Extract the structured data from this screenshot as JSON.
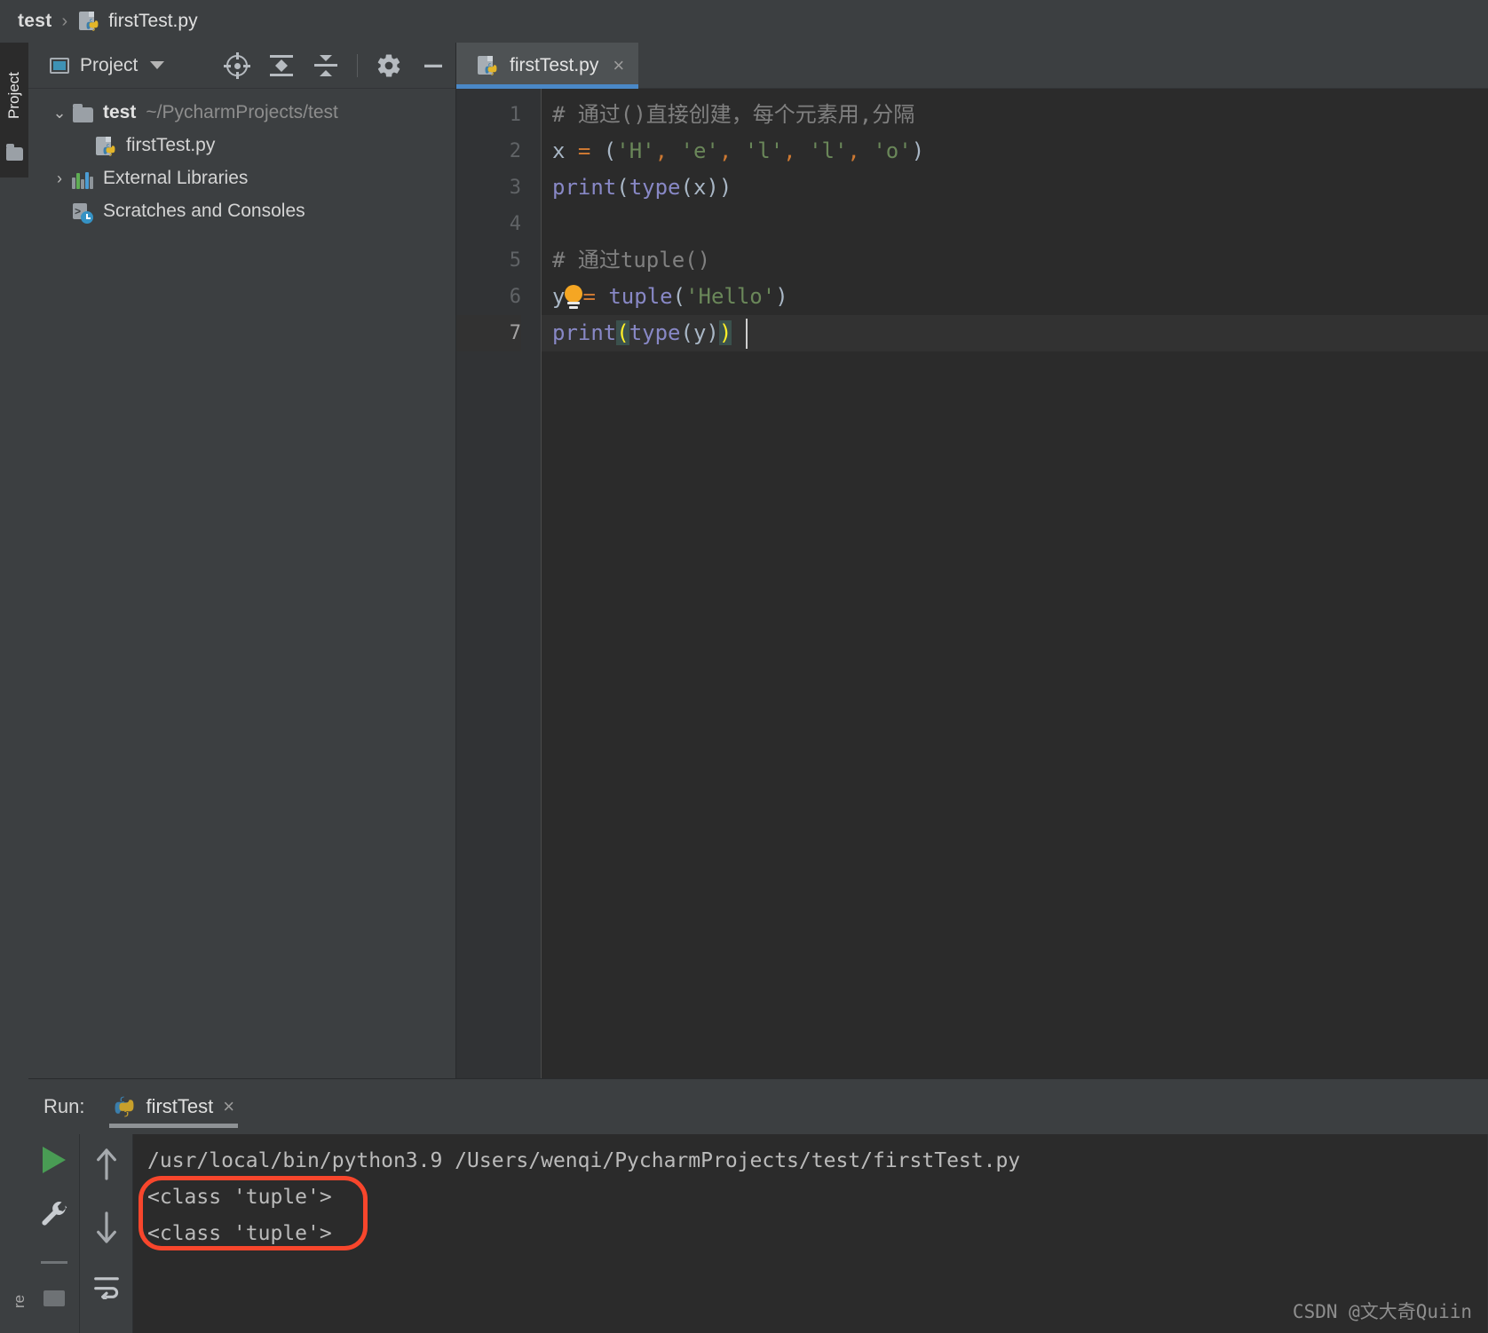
{
  "breadcrumb": {
    "project": "test",
    "separator": "›",
    "file": "firstTest.py"
  },
  "left_strip": {
    "project_label": "Project",
    "bottom_label": "re"
  },
  "project_panel": {
    "title": "Project",
    "toolbar": [
      {
        "name": "locate-icon",
        "label": "Select Opened File"
      },
      {
        "name": "expand-all-icon",
        "label": "Expand All"
      },
      {
        "name": "collapse-all-icon",
        "label": "Collapse All"
      },
      {
        "name": "gear-icon",
        "label": "Settings"
      },
      {
        "name": "minimize-icon",
        "label": "Hide"
      }
    ],
    "tree": [
      {
        "arrow": "⌄",
        "icon": "folder-icon",
        "name": "test",
        "path": "~/PycharmProjects/test",
        "bold": true,
        "indent": 0
      },
      {
        "arrow": "",
        "icon": "python-file-icon",
        "name": "firstTest.py",
        "path": "",
        "bold": false,
        "indent": 1
      },
      {
        "arrow": "›",
        "icon": "libraries-icon",
        "name": "External Libraries",
        "path": "",
        "bold": false,
        "indent": 0
      },
      {
        "arrow": "",
        "icon": "scratches-icon",
        "name": "Scratches and Consoles",
        "path": "",
        "bold": false,
        "indent": 0
      }
    ]
  },
  "editor": {
    "tab": {
      "label": "firstTest.py",
      "close": "×",
      "accent": "#4A88C7"
    },
    "line_numbers": [
      "1",
      "2",
      "3",
      "4",
      "5",
      "6",
      "7"
    ],
    "current_line": 7,
    "lines": [
      {
        "n": 1,
        "text": "# 通过()直接创建，每个元素用,分隔"
      },
      {
        "n": 2,
        "text": "x = ('H', 'e', 'l', 'l', 'o')"
      },
      {
        "n": 3,
        "text": "print(type(x))"
      },
      {
        "n": 4,
        "text": ""
      },
      {
        "n": 5,
        "text": "# 通过tuple()"
      },
      {
        "n": 6,
        "text": "y = tuple('Hello')"
      },
      {
        "n": 7,
        "text": "print(type(y))"
      }
    ],
    "colors": {
      "comment": "#808080",
      "string": "#6A8759",
      "operator": "#CC7832",
      "function": "#8888C6",
      "default": "#A9B7C6",
      "bracket_match": "#FFEF28",
      "background": "#2B2B2B",
      "gutter": "#313335"
    },
    "inspection_bulb": "lightbulb-icon"
  },
  "run_panel": {
    "label": "Run:",
    "tab_name": "firstTest",
    "tab_close": "×",
    "controls": [
      {
        "name": "run-button",
        "label": "Run"
      },
      {
        "name": "wrench-icon",
        "label": "Settings"
      },
      {
        "name": "arrow-up-icon",
        "label": "Previous"
      },
      {
        "name": "arrow-down-icon",
        "label": "Next"
      },
      {
        "name": "soft-wrap-icon",
        "label": "Soft-Wrap"
      }
    ],
    "console_lines": [
      "/usr/local/bin/python3.9 /Users/wenqi/PycharmProjects/test/firstTest.py",
      "<class 'tuple'>",
      "<class 'tuple'>"
    ],
    "highlight_color": "#F8462C"
  },
  "watermark": "CSDN @文大奇Quiin"
}
